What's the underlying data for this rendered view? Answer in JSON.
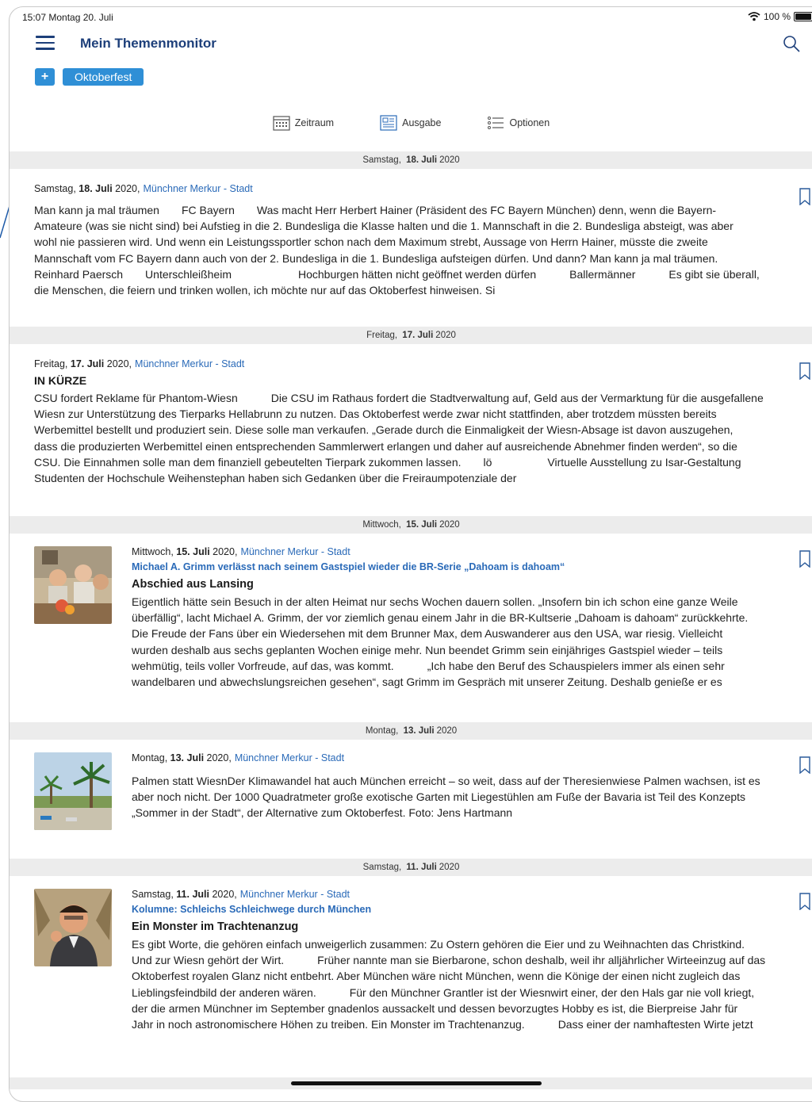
{
  "status": {
    "time_date": "15:07  Montag 20. Juli",
    "battery": "100 %"
  },
  "nav": {
    "title": "Mein Themenmonitor"
  },
  "chips": {
    "add": "+",
    "topic": "Oktoberfest"
  },
  "toolbar": {
    "zeitraum": "Zeitraum",
    "ausgabe": "Ausgabe",
    "optionen": "Optionen"
  },
  "days": [
    {
      "weekday": "Samstag,",
      "date": "18. Juli",
      "year": "2020"
    },
    {
      "weekday": "Freitag,",
      "date": "17. Juli",
      "year": "2020"
    },
    {
      "weekday": "Mittwoch,",
      "date": "15. Juli",
      "year": "2020"
    },
    {
      "weekday": "Montag,",
      "date": "13. Juli",
      "year": "2020"
    },
    {
      "weekday": "Samstag,",
      "date": "11. Juli",
      "year": "2020"
    }
  ],
  "articles": [
    {
      "weekday": "Samstag,",
      "date": "18. Juli",
      "year": "2020,",
      "source": "Münchner Merkur - Stadt",
      "lines": [
        "Man kann ja mal träumen  FC Bayern  Was macht Herr Herbert Hainer (Präsident des FC Bayern München) denn, wenn die Bayern-",
        "Amateure (was sie nicht sind) bei Aufstieg in die 2. Bundesliga die Klasse halten und die 1. Mannschaft in die 2. Bundesliga absteigt, was aber",
        "wohl nie passieren wird. Und wenn ein Leistungssportler schon nach dem Maximum strebt, Aussage von Herrn Hainer, müsste die zweite",
        "Mannschaft vom FC Bayern dann auch von der 2. Bundesliga in die 1. Bundesliga aufsteigen dürfen. Und dann? Man kann ja mal träumen.",
        "Reinhard Paersch  Unterschleißheim      Hochburgen hätten nicht geöffnet werden dürfen   Ballermänner   Es gibt sie überall,",
        "die Menschen, die feiern und trinken wollen, ich möchte nur auf das Oktoberfest hinweisen. Si"
      ]
    },
    {
      "weekday": "Freitag,",
      "date": "17. Juli",
      "year": "2020,",
      "source": "Münchner Merkur - Stadt",
      "headline": "IN KÜRZE",
      "lines": [
        "CSU fordert Reklame für Phantom-Wiesn   Die CSU im Rathaus fordert die Stadtverwaltung auf, Geld aus der Vermarktung für die ausgefallene",
        "Wiesn zur Unterstützung des Tierparks Hellabrunn zu nutzen. Das Oktoberfest werde zwar nicht stattfinden, aber trotzdem müssten bereits",
        "Werbemittel bestellt und produziert sein. Diese solle man verkaufen. „Gerade durch die Einmaligkeit der Wiesn-Absage ist davon auszugehen,",
        "dass die produzierten Werbemittel einen entsprechenden Sammlerwert erlangen und daher auf ausreichende Abnehmer finden werden“, so die",
        "CSU. Die Einnahmen solle man dem finanziell gebeutelten Tierpark zukommen lassen.  lö     Virtuelle Ausstellung  zu Isar-Gestaltung",
        "Studenten der Hochschule Weihenstephan haben sich Gedanken über die Freiraumpotenziale der"
      ]
    },
    {
      "weekday": "Mittwoch,",
      "date": "15. Juli",
      "year": "2020,",
      "source": "Münchner Merkur - Stadt",
      "subtitle": "Michael A. Grimm verlässt nach seinem Gastspiel wieder die BR-Serie „Dahoam is dahoam“",
      "headline": "Abschied aus Lansing",
      "lines": [
        "Eigentlich hätte sein Besuch in der alten Heimat nur sechs Wochen dauern sollen. „Insofern bin ich schon eine ganze Weile",
        "überfällig“, lacht Michael A. Grimm, der vor ziemlich genau einem Jahr in die BR-Kultserie „Dahoam is dahoam“ zurückkehrte.",
        "Die Freude der Fans über ein Wiedersehen mit dem Brunner Max, dem Auswanderer aus den USA, war riesig. Vielleicht",
        "wurden deshalb aus sechs geplanten Wochen einige mehr. Nun beendet Grimm sein einjähriges Gastspiel wieder – teils",
        "wehmütig, teils voller Vorfreude, auf das, was kommt.   „Ich habe den Beruf des Schauspielers immer als einen sehr",
        "wandelbaren und abwechslungsreichen gesehen“, sagt Grimm im Gespräch mit unserer Zeitung. Deshalb genieße er es"
      ]
    },
    {
      "weekday": "Montag,",
      "date": "13. Juli",
      "year": "2020,",
      "source": "Münchner Merkur - Stadt",
      "lines": [
        "Palmen statt WiesnDer Klimawandel hat auch München erreicht – so weit, dass auf der Theresienwiese Palmen wachsen, ist es",
        "aber noch nicht. Der 1000 Quadratmeter große exotische Garten mit Liegestühlen am Fuße der Bavaria ist Teil des Konzepts",
        "„Sommer in der Stadt“, der Alternative zum Oktoberfest. Foto: Jens Hartmann"
      ]
    },
    {
      "weekday": "Samstag,",
      "date": "11. Juli",
      "year": "2020,",
      "source": "Münchner Merkur - Stadt",
      "subtitle": "Kolumne: Schleichs Schleichwege durch München",
      "headline": "Ein Monster im Trachtenanzug",
      "lines": [
        "Es gibt Worte, die gehören einfach unweigerlich zusammen: Zu Ostern gehören die Eier und zu Weihnachten das Christkind.",
        "Und zur Wiesn gehört der Wirt.   Früher nannte man sie Bierbarone, schon deshalb, weil ihr alljährlicher Wirteeinzug auf das",
        "Oktoberfest royalen Glanz nicht entbehrt. Aber München wäre nicht München, wenn die Könige der einen nicht zugleich das",
        "Lieblingsfeindbild der anderen wären.   Für den Münchner Grantler ist der Wiesnwirt einer, der den Hals gar nie voll kriegt,",
        "der die armen Münchner im September gnadenlos aussackelt und dessen bevorzugtes Hobby es ist, die Bierpreise Jahr für",
        "Jahr in noch astronomischere Höhen zu treiben. Ein Monster im Trachtenanzug.   Dass einer der namhaftesten Wirte jetzt"
      ]
    }
  ]
}
